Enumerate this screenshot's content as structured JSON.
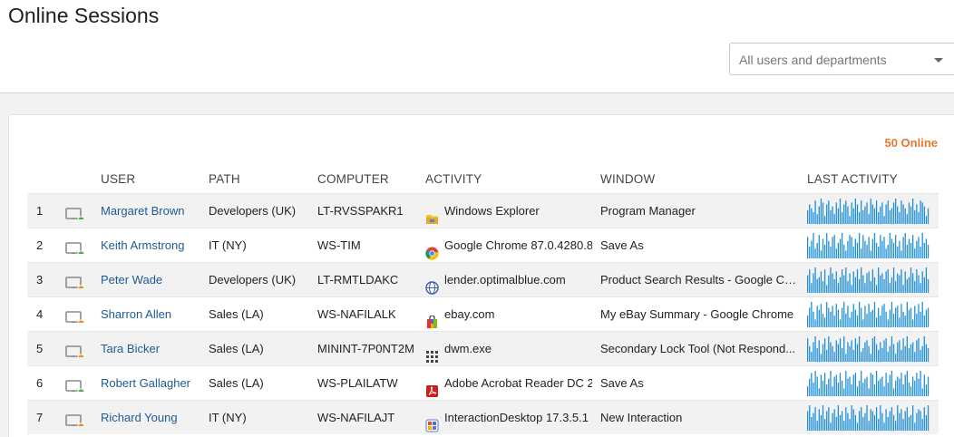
{
  "page": {
    "title": "Online Sessions",
    "filter_value": "All users and departments",
    "online_count": "50 Online"
  },
  "colors": {
    "accent_orange": "#e8772e",
    "link_blue": "#1f5a93",
    "spark_blue": "#1c8ed6",
    "status_active": "#3cb34a",
    "status_idle": "#f28a1c"
  },
  "table": {
    "columns": [
      "USER",
      "PATH",
      "COMPUTER",
      "ACTIVITY",
      "WINDOW",
      "LAST ACTIVITY"
    ],
    "rows": [
      {
        "num": "1",
        "status": "active",
        "user": "Margaret Brown",
        "path": "Developers (UK)",
        "computer": "LT-RVSSPAKR1",
        "activity_icon": "folder-icon",
        "activity": "Windows Explorer",
        "window": "Program Manager",
        "spark": [
          7,
          10,
          8,
          6,
          12,
          5,
          9,
          13,
          11,
          4,
          10,
          12,
          7,
          9,
          5,
          11,
          8,
          13,
          6,
          10,
          12,
          9,
          4,
          11,
          8,
          13,
          10,
          6,
          12,
          7,
          9,
          11,
          5,
          13,
          10,
          8,
          12,
          6,
          9,
          11,
          4,
          10,
          12,
          7,
          8,
          11,
          13,
          9,
          6,
          12,
          10,
          8,
          5,
          11,
          9,
          13,
          7,
          10,
          6,
          12,
          11,
          9,
          4,
          8
        ]
      },
      {
        "num": "2",
        "status": "active",
        "user": "Keith Armstrong",
        "path": "IT (NY)",
        "computer": "WS-TIM",
        "activity_icon": "chrome-icon",
        "activity": "Google Chrome 87.0.4280.8",
        "window": "Save As",
        "spark": [
          11,
          6,
          9,
          13,
          5,
          8,
          12,
          4,
          10,
          7,
          13,
          9,
          6,
          11,
          12,
          5,
          8,
          10,
          13,
          7,
          4,
          9,
          12,
          11,
          6,
          10,
          8,
          13,
          5,
          12,
          9,
          7,
          11,
          4,
          10,
          13,
          8,
          6,
          12,
          9,
          11,
          5,
          7,
          13,
          10,
          8,
          12,
          6,
          9,
          4,
          11,
          13,
          7,
          10,
          8,
          12,
          5,
          9,
          11,
          6,
          13,
          8,
          10,
          7
        ]
      },
      {
        "num": "3",
        "status": "idle",
        "user": "Peter Wade",
        "path": "Developers (UK)",
        "computer": "LT-RMTLDAKC",
        "activity_icon": "globe-icon",
        "activity": "lender.optimalblue.com",
        "window": "Product Search Results - Google Ch...",
        "spark": [
          9,
          12,
          5,
          10,
          13,
          7,
          8,
          11,
          6,
          12,
          4,
          9,
          13,
          10,
          7,
          11,
          5,
          8,
          12,
          9,
          13,
          6,
          10,
          4,
          11,
          8,
          12,
          7,
          13,
          9,
          5,
          10,
          11,
          6,
          12,
          8,
          4,
          13,
          9,
          10,
          7,
          11,
          12,
          5,
          8,
          13,
          6,
          10,
          9,
          12,
          4,
          11,
          7,
          8,
          13,
          10,
          6,
          12,
          9,
          5,
          11,
          8,
          13,
          7
        ]
      },
      {
        "num": "4",
        "status": "idle",
        "user": "Sharron Allen",
        "path": "Sales (LA)",
        "computer": "WS-NAFILALK",
        "activity_icon": "shopping-bag-icon",
        "activity": "ebay.com",
        "window": "My eBay Summary - Google Chrome",
        "spark": [
          6,
          10,
          13,
          8,
          4,
          11,
          9,
          12,
          7,
          5,
          13,
          10,
          8,
          11,
          6,
          12,
          9,
          4,
          10,
          13,
          7,
          11,
          5,
          8,
          12,
          9,
          6,
          13,
          10,
          4,
          11,
          7,
          12,
          8,
          9,
          13,
          5,
          10,
          6,
          11,
          12,
          8,
          4,
          9,
          13,
          7,
          10,
          11,
          5,
          12,
          8,
          6,
          13,
          9,
          10,
          4,
          11,
          7,
          12,
          8,
          13,
          6,
          9,
          10
        ]
      },
      {
        "num": "5",
        "status": "idle",
        "user": "Tara Bicker",
        "path": "Sales (LA)",
        "computer": "MININT-7P0NT2M",
        "activity_icon": "grid-icon",
        "activity": "dwm.exe",
        "window": "Secondary Lock Tool (Not Respond...",
        "spark": [
          12,
          8,
          5,
          10,
          13,
          7,
          11,
          4,
          9,
          12,
          6,
          13,
          10,
          8,
          5,
          11,
          9,
          12,
          7,
          13,
          4,
          10,
          8,
          11,
          6,
          12,
          9,
          13,
          5,
          7,
          10,
          11,
          8,
          4,
          12,
          13,
          9,
          6,
          10,
          7,
          11,
          12,
          5,
          8,
          13,
          9,
          4,
          10,
          11,
          6,
          12,
          8,
          13,
          7,
          9,
          10,
          5,
          11,
          12,
          6,
          8,
          13,
          9,
          7
        ]
      },
      {
        "num": "6",
        "status": "active",
        "user": "Robert Gallagher",
        "path": "Sales (LA)",
        "computer": "WS-PLAILATW",
        "activity_icon": "pdf-icon",
        "activity": "Adobe Acrobat Reader DC 2",
        "window": "Save As",
        "spark": [
          5,
          9,
          12,
          7,
          13,
          10,
          4,
          11,
          8,
          12,
          6,
          9,
          13,
          5,
          10,
          11,
          7,
          12,
          8,
          4,
          13,
          9,
          10,
          6,
          11,
          12,
          5,
          8,
          13,
          7,
          9,
          10,
          4,
          12,
          11,
          6,
          13,
          8,
          9,
          10,
          5,
          12,
          7,
          11,
          13,
          4,
          8,
          10,
          9,
          12,
          6,
          11,
          13,
          7,
          5,
          10,
          8,
          12,
          9,
          13,
          4,
          11,
          6,
          10
        ]
      },
      {
        "num": "7",
        "status": "idle",
        "user": "Richard Young",
        "path": "IT (NY)",
        "computer": "WS-NAFILAJT",
        "activity_icon": "app-icon",
        "activity": "InteractionDesktop 17.3.5.1",
        "window": "New Interaction",
        "spark": [
          10,
          13,
          7,
          9,
          12,
          5,
          11,
          8,
          13,
          6,
          10,
          12,
          4,
          9,
          11,
          7,
          13,
          8,
          10,
          5,
          12,
          9,
          6,
          13,
          11,
          8,
          4,
          10,
          12,
          7,
          9,
          13,
          5,
          11,
          10,
          8,
          12,
          6,
          13,
          9,
          4,
          11,
          7,
          10,
          12,
          8,
          5,
          13,
          9,
          11,
          6,
          10,
          12,
          7,
          8,
          13,
          4,
          9,
          11,
          10,
          6,
          12,
          8,
          13
        ]
      }
    ]
  }
}
